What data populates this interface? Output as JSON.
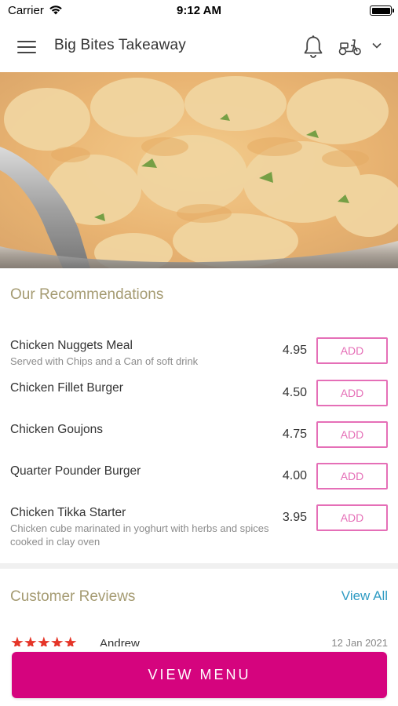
{
  "status_bar": {
    "carrier": "Carrier",
    "time": "9:12 AM"
  },
  "header": {
    "title": "Big Bites Takeaway",
    "icons": [
      "menu-icon",
      "bell-icon",
      "scooter-icon",
      "chevron-down-icon"
    ]
  },
  "recommendations": {
    "title": "Our Recommendations",
    "add_label": "ADD",
    "items": [
      {
        "name": "Chicken Nuggets Meal",
        "description": "Served with Chips and a Can of soft drink",
        "price": "4.95"
      },
      {
        "name": "Chicken Fillet Burger",
        "description": "",
        "price": "4.50"
      },
      {
        "name": "Chicken Goujons",
        "description": "",
        "price": "4.75"
      },
      {
        "name": "Quarter Pounder Burger",
        "description": "",
        "price": "4.00"
      },
      {
        "name": "Chicken Tikka Starter",
        "description": "Chicken cube marinated in yoghurt with herbs and spices cooked in clay oven",
        "price": "3.95"
      }
    ]
  },
  "reviews": {
    "title": "Customer Reviews",
    "view_all": "View All",
    "first": {
      "stars": "★★★★★",
      "rating": 5,
      "name": "Andrew",
      "date": "12 Jan 2021"
    }
  },
  "cta": {
    "label": "VIEW MENU"
  },
  "colors": {
    "accent": "#d5047e",
    "add_border": "#e56fb7",
    "section_title": "#a59b72",
    "link": "#2e9bc3",
    "stars": "#e53528"
  }
}
